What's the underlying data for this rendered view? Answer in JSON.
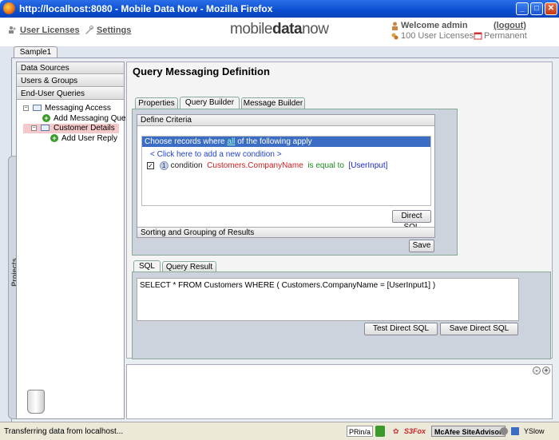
{
  "window": {
    "title": "http://localhost:8080 - Mobile Data Now - Mozilla Firefox",
    "min_glyph": "_",
    "max_glyph": "□",
    "close_glyph": "✕"
  },
  "header": {
    "user_licenses": "User Licenses",
    "settings": "Settings",
    "logo_plain": "mobile",
    "logo_bold": "data",
    "logo_end": "now",
    "welcome": "Welcome  admin",
    "logout": "(logout)",
    "licenses": "100 User Licenses",
    "permanent": "Permanent"
  },
  "project_tab": "Sample1",
  "projects_label": "Projects",
  "sidebar": {
    "sections": [
      "Data Sources",
      "Users & Groups",
      "End-User Queries"
    ],
    "tree": {
      "root": "Messaging Access",
      "add_query": "Add Messaging Quer",
      "selected": "Customer Details",
      "add_reply": "Add User Reply",
      "collapse_glyph": "−",
      "add_glyph": "+"
    }
  },
  "main": {
    "title": "Query Messaging Definition",
    "tabs": [
      "Properties",
      "Query Builder",
      "Message Builder"
    ],
    "active_tab": "Query Builder",
    "define_criteria": "Define Criteria",
    "choose_prefix": "Choose records where",
    "choose_all": "all",
    "choose_suffix": "of the following apply",
    "add_condition": "< Click here to add a new condition >",
    "condition": {
      "checked": true,
      "checkmark": "✓",
      "number": "1",
      "word": "condition",
      "field": "Customers.CompanyName",
      "operator": "is equal to",
      "value": "[UserInput]"
    },
    "direct_sql_button": "Direct SQL",
    "sorting_label": "Sorting and Grouping of Results",
    "save_button": "Save",
    "sql_tabs": [
      "SQL",
      "Query Result"
    ],
    "sql_text": "SELECT * FROM Customers WHERE ( Customers.CompanyName  =  [UserInput1] )",
    "test_sql_button": "Test Direct SQL",
    "save_sql_button": "Save Direct SQL",
    "zoom_out": "-",
    "zoom_in": "+"
  },
  "statusbar": {
    "text": "Transferring data from localhost...",
    "print": "PRin/a",
    "s3fox": "S3Fox",
    "mcafee": "McAfee SiteAdvisor",
    "yslow": "YSlow"
  },
  "colors": {
    "accent": "#3c6dc4",
    "title_blue": "#0a4ed0",
    "selected_row": "#f5c9c9"
  }
}
